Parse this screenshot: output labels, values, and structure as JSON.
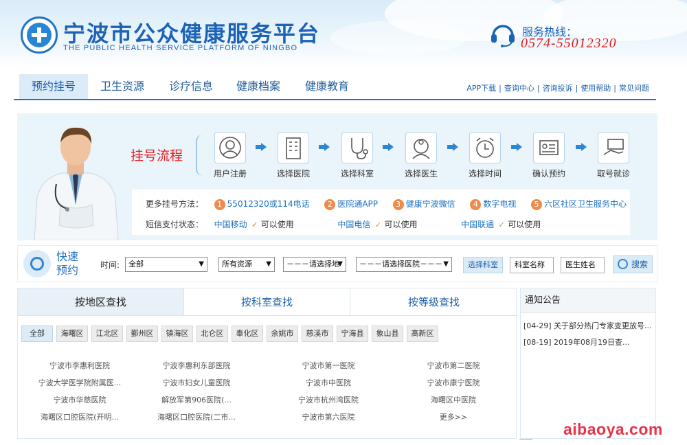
{
  "header": {
    "title": "宁波市公众健康服务平台",
    "subtitle": "THE PUBLIC HEALTH SERVICE PLATFORM OF NINGBO",
    "hotline_label": "服务热线：",
    "hotline_number": "0574-55012320"
  },
  "nav": {
    "tabs": [
      {
        "label": "预约挂号"
      },
      {
        "label": "卫生资源"
      },
      {
        "label": "诊疗信息"
      },
      {
        "label": "健康档案"
      },
      {
        "label": "健康教育"
      }
    ],
    "links": [
      "APP下载",
      "查询中心",
      "咨询投诉",
      "使用帮助",
      "常见问题"
    ],
    "sep": "|"
  },
  "process": {
    "title": "挂号流程",
    "steps": [
      {
        "label": "用户注册",
        "icon": "user-icon"
      },
      {
        "label": "选择医院",
        "icon": "hospital-building-icon"
      },
      {
        "label": "选择科室",
        "icon": "stethoscope-icon"
      },
      {
        "label": "选择医生",
        "icon": "doctor-icon"
      },
      {
        "label": "选择时间",
        "icon": "alarm-clock-icon"
      },
      {
        "label": "确认预约",
        "icon": "id-card-icon"
      },
      {
        "label": "取号就诊",
        "icon": "card-hand-icon"
      }
    ]
  },
  "methods": {
    "label": "更多挂号方法：",
    "items": [
      {
        "num": "1",
        "text": "55012320或114电话"
      },
      {
        "num": "2",
        "text": "医院通APP"
      },
      {
        "num": "3",
        "text": "健康宁波微信"
      },
      {
        "num": "4",
        "text": "数字电视"
      },
      {
        "num": "5",
        "text": "六区社区卫生服务中心"
      }
    ],
    "sms_label": "短信支付状态：",
    "carriers": [
      {
        "name": "中国移动",
        "status": "可以使用"
      },
      {
        "name": "中国电信",
        "status": "可以使用"
      },
      {
        "name": "中国联通",
        "status": "可以使用"
      }
    ]
  },
  "quick": {
    "label1": "快速",
    "label2": "预约",
    "time_label": "时间:",
    "time_value": "全部",
    "resource_value": "所有资源",
    "area_value": "－－－请选择地",
    "hospital_value": "－－－请选择医院－－－",
    "dept_button": "选择科室",
    "dept_name_placeholder": "科室名称",
    "doctor_name_placeholder": "医生姓名",
    "search_button": "搜索",
    "arrow": "▼"
  },
  "search_tabs": [
    {
      "label": "按地区查找"
    },
    {
      "label": "按科室查找"
    },
    {
      "label": "按等级查找"
    }
  ],
  "regions": [
    "全部",
    "海曙区",
    "江北区",
    "鄞州区",
    "镇海区",
    "北仑区",
    "奉化区",
    "余姚市",
    "慈溪市",
    "宁海县",
    "象山县",
    "高新区"
  ],
  "hospitals": [
    [
      "宁波市李惠利医院",
      "宁波李惠利东部医院",
      "宁波市第一医院",
      "宁波市第二医院"
    ],
    [
      "宁波大学医学院附属医...",
      "宁波市妇女儿童医院",
      "宁波市中医院",
      "宁波市康宁医院"
    ],
    [
      "宁波市华慈医院",
      "解放军第906医院(...",
      "宁波市杭州湾医院",
      "海曙区中医院"
    ],
    [
      "海曙区口腔医院(开明...",
      "海曙区口腔医院(二市...",
      "宁波市第六医院",
      "更多>>"
    ]
  ],
  "notice": {
    "title": "通知公告",
    "items": [
      {
        "date": "[04-29]",
        "text": "关于部分热门专家变更放号..."
      },
      {
        "date": "[08-19]",
        "text": "2019年08月19日查..."
      }
    ]
  },
  "watermark": "aibaoya.com",
  "colors": {
    "brand": "#1c62b5",
    "accent": "#e42020",
    "badge": "#f08a4b",
    "hotline": "#e31b1b"
  }
}
